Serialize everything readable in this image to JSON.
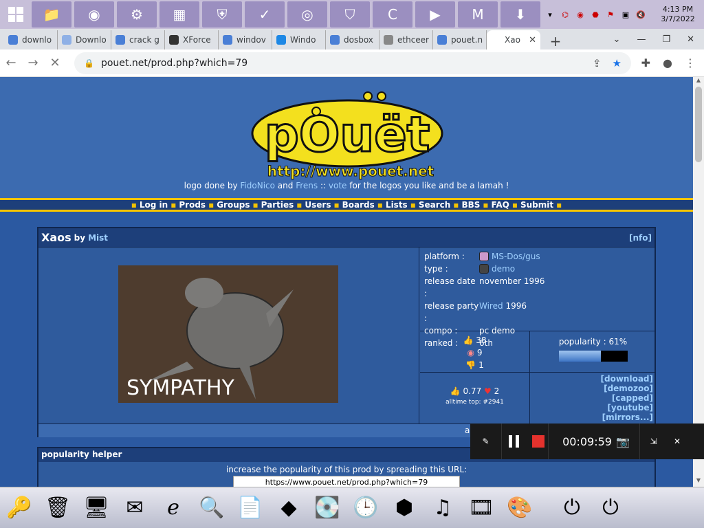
{
  "taskbar": {
    "apps": [
      {
        "name": "file-explorer",
        "glyph": "📁"
      },
      {
        "name": "chrome",
        "glyph": "◉"
      },
      {
        "name": "settings",
        "glyph": "⚙"
      },
      {
        "name": "control-panel",
        "glyph": "▦"
      },
      {
        "name": "vpn-shield",
        "glyph": "⛨"
      },
      {
        "name": "security-check",
        "glyph": "✓"
      },
      {
        "name": "app-red",
        "glyph": "◎"
      },
      {
        "name": "app-shield-blue",
        "glyph": "⛉"
      },
      {
        "name": "ccleaner",
        "glyph": "C"
      },
      {
        "name": "screen-recorder",
        "glyph": "▶"
      },
      {
        "name": "malwarebytes",
        "glyph": "M"
      },
      {
        "name": "installer",
        "glyph": "⬇"
      }
    ],
    "clock_time": "4:13 PM",
    "clock_date": "3/7/2022"
  },
  "browser": {
    "tabs": [
      {
        "label": "downlo",
        "icon_color": "#4a7fd6"
      },
      {
        "label": "Downlo",
        "icon_color": "#8fb0e6"
      },
      {
        "label": "crack g",
        "icon_color": "#4a7fd6"
      },
      {
        "label": "XForce",
        "icon_color": "#333333"
      },
      {
        "label": "windov",
        "icon_color": "#4a7fd6"
      },
      {
        "label": "Windo",
        "icon_color": "#1e88e5"
      },
      {
        "label": "dosbox",
        "icon_color": "#4a7fd6"
      },
      {
        "label": "ethceer",
        "icon_color": "#888888"
      },
      {
        "label": "pouet.n",
        "icon_color": "#4a7fd6"
      },
      {
        "label": "Xao",
        "icon_color": "#ffffff",
        "active": true
      }
    ],
    "url": "pouet.net/prod.php?which=79"
  },
  "page": {
    "logo_text": "pOuët",
    "logo_url_text": "http://www.pouet.net",
    "credit_prefix": "logo done by",
    "credit_author1": "FidoNico",
    "credit_and": "and",
    "credit_author2": "Frens",
    "credit_sep": "::",
    "credit_vote": "vote",
    "credit_suffix": "for the logos you like and be a lamah !",
    "nav": [
      "Log in",
      "Prods",
      "Groups",
      "Parties",
      "Users",
      "Boards",
      "Lists",
      "Search",
      "BBS",
      "FAQ",
      "Submit"
    ],
    "prod": {
      "title": "Xaos",
      "by": "by",
      "group": "Mist",
      "nfo": "[nfo]",
      "screenshot_text": "SYMPATHY",
      "platform_label": "platform :",
      "platform": "MS-Dos/gus",
      "type_label": "type :",
      "type": "demo",
      "release_date_label": "release date :",
      "release_date": "november 1996",
      "release_party_label": "release party :",
      "release_party": "Wired",
      "release_party_year": "1996",
      "compo_label": "compo :",
      "compo": "pc demo",
      "ranked_label": "ranked :",
      "ranked": "6th",
      "thumbs_up": "38",
      "piggie": "9",
      "thumbs_down": "1",
      "popularity_label": "popularity : 61%",
      "popularity": 0.61,
      "avg_score": "0.77",
      "cdcs": "2",
      "alltime": "alltime top: #2941",
      "links": [
        "[download]",
        "[demozoo]",
        "[capped]",
        "[youtube]",
        "[mirrors...]"
      ],
      "footer_text": "ad"
    },
    "helper": {
      "title": "popularity helper",
      "text": "increase the popularity of this prod by spreading this URL:",
      "url": "https://www.pouet.net/prod.php?which=79"
    }
  },
  "recorder": {
    "time": "00:09:59"
  },
  "dock": {
    "items": [
      {
        "name": "keychain-icon",
        "glyph": "🔑"
      },
      {
        "name": "trash-icon",
        "glyph": "🗑"
      },
      {
        "name": "network-icon",
        "glyph": "🖥"
      },
      {
        "name": "mail-icon",
        "glyph": "✉"
      },
      {
        "name": "ie-icon",
        "glyph": "ℯ"
      },
      {
        "name": "search-icon",
        "glyph": "🔍"
      },
      {
        "name": "rtf-icon",
        "glyph": "📄"
      },
      {
        "name": "cube-icon",
        "glyph": "◆"
      },
      {
        "name": "drive-icon",
        "glyph": "💽"
      },
      {
        "name": "clock-folder-icon",
        "glyph": "🕒"
      },
      {
        "name": "gear-hex-icon",
        "glyph": "⬢"
      },
      {
        "name": "music-icon",
        "glyph": "♫"
      },
      {
        "name": "media-icon",
        "glyph": "🎞"
      },
      {
        "name": "paint-icon",
        "glyph": "🎨"
      },
      {
        "name": "logoff-icon",
        "glyph": "⏻"
      },
      {
        "name": "power-icon",
        "glyph": "⏻"
      }
    ]
  }
}
